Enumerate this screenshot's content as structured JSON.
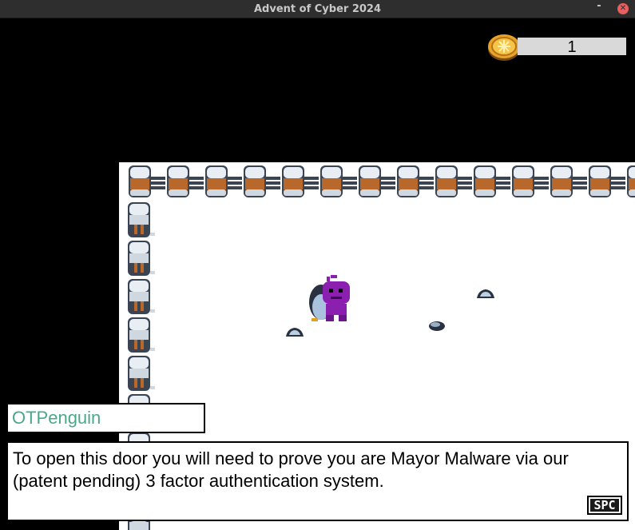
{
  "window": {
    "title": "Advent of Cyber 2024",
    "minimize_glyph": "-",
    "close_glyph": "✕"
  },
  "hud": {
    "coin_count": "1",
    "coin_icon": "gold-coin-icon"
  },
  "scene": {
    "character_icon": "purple-player-character",
    "companion_icon": "penguin-companion",
    "colors": {
      "snow": "#ffffff",
      "void": "#000000",
      "fence_cap": "#dfe7ee",
      "fence_wood": "#b7682a",
      "character": "#8a1fb0"
    }
  },
  "dialogue": {
    "speaker": "OTPenguin",
    "text": "To open this door you will need to prove you are Mayor Malware via our\n(patent pending) 3 factor authentication system.",
    "continue_key": "SPC"
  }
}
